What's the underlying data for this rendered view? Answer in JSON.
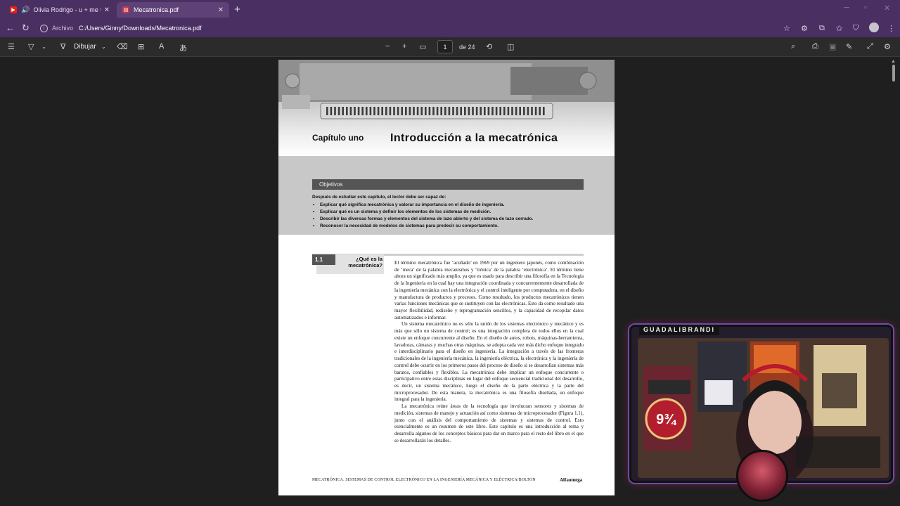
{
  "tabs": [
    {
      "title": "Olivia Rodrigo - u + me = ▯ (l",
      "active": false,
      "audio": true,
      "favicon": "youtube-icon"
    },
    {
      "title": "Mecatronica.pdf",
      "active": true,
      "audio": false,
      "favicon": "pdf-icon"
    }
  ],
  "addressbar": {
    "scheme": "Archivo",
    "url": "C:/Users/Ginny/Downloads/Mecatronica.pdf"
  },
  "pdf_toolbar": {
    "draw_label": "Dibujar",
    "current_page": "1",
    "page_count": "de 24"
  },
  "document": {
    "chapter_label": "Capítulo uno",
    "chapter_title": "Introducción a la mecatrónica",
    "objectives_heading": "Objetivos",
    "objectives_intro": "Después de estudiar este capítulo, el lector debe ser capaz de:",
    "objectives": [
      "Explicar qué significa mecatrónica y valorar su importancia en el diseño de ingeniería.",
      "Explicar qué es un sistema y definir los elementos de los sistemas de medición.",
      "Describir las diversas formas y elementos del sistema de lazo abierto y del sistema de lazo cerrado.",
      "Reconocer la necesidad de modelos de sistemas para predecir su comportamiento."
    ],
    "section_number": "1.1",
    "section_title": "¿Qué es la mecatrónica?",
    "paragraphs": [
      "El término mecatrónica fue ‘acuñado’ en 1969 por un ingeniero japonés, como combinación de ‘meca’ de la palabra mecanismos y ‘trónica’ de la palabra ‘electrónica’. El término tiene ahora un significado más amplio, ya que es usado para describir una filosofía en la Tecnología de la Ingeniería en la cual hay una integración coordinada y concurrentemente desarrollada de la ingeniería mecánica con la electrónica y el control inteligente por computadora, en el diseño y manufactura de productos y procesos. Como resultado, los productos mecatrónicos tienen varias funciones mecánicas que se sustituyen con las electrónicas. Esto da como resultado una mayor flexibilidad, rediseño y reprogramación sencillos, y la capacidad de recopilar datos automatizados e informar.",
      "Un sistema mecatrónico no es sólo la unión de los sistemas electrónico y mecánico y es más que sólo un sistema de control; es una integración completa de todos ellos en la cual existe un enfoque concurrente al diseño. En el diseño de autos, robots, máquinas-herramienta, lavadoras, cámaras y muchas otras máquinas, se adopta cada vez más dicho enfoque integrado e interdisciplinario para el diseño en ingeniería. La integración a través de las fronteras tradicionales de la ingeniería mecánica, la ingeniería eléctrica, la electrónica y la ingeniería de control debe ocurrir en los primeros pasos del proceso de diseño si se desarrollan sistemas más baratos, confiables y flexibles. La mecatrónica debe implicar un enfoque concurrente o participativo entre estas disciplinas en lugar del enfoque secuencial tradicional del desarrollo, es decir, un sistema mecánico, luego el diseño de la parte eléctrica y la parte del microprocesador. De esta manera, la mecatrónica es una filosofía diseñada, un enfoque integral para la ingeniería.",
      "La mecatrónica reúne áreas de la tecnología que involucran sensores y sistemas de medición, sistemas de manejo y actuación así como sistemas de microprocesador (Figura 1.1), junto con el análisis del comportamiento de sistemas y sistemas de control. Esto esencialmente es un resumen de este libro. Este capítulo es una introducción al tema y desarrolla algunos de los conceptos básicos para dar un marco para el resto del libro en el que se desarrollarán los detalles."
    ],
    "footer_left": "MECATRÓNICA. SISTEMAS DE CONTROL ELECTRÓNICO EN LA INGENIERÍA MECÁNICA Y ELÉCTRICA/BOLTON",
    "footer_right": "Alfaomega"
  },
  "webcam": {
    "streamer_name": "GUADALIBRANDI"
  },
  "colors": {
    "titlebar": "#4a2f63",
    "active_tab": "#5d4177",
    "toolbar": "#2b2b2b",
    "viewer_bg": "#1f1f1f",
    "objectives_bg": "#c8c8c8"
  }
}
